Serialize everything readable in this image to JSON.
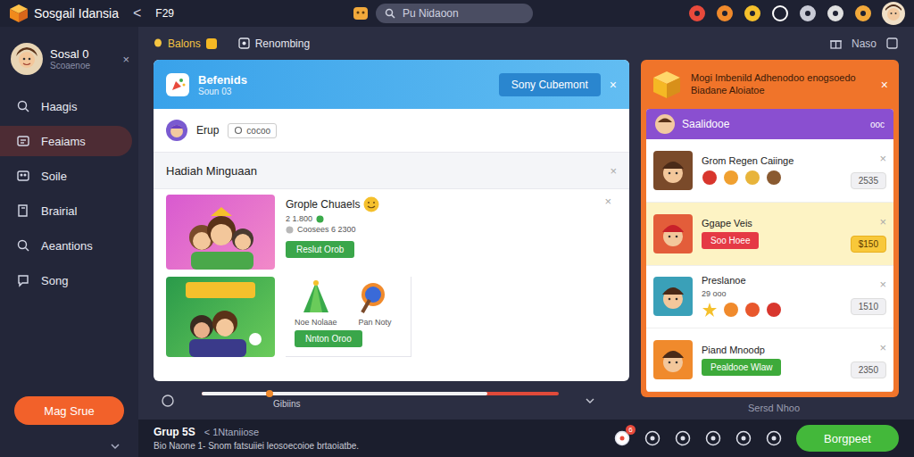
{
  "app": {
    "title": "Sosgail Idansia",
    "back": "<",
    "counter": "F29"
  },
  "search": {
    "placeholder": "Pu Nidaoon"
  },
  "sidebar": {
    "profile": {
      "name": "Sosal 0",
      "subtitle": "Scoaenoe",
      "close": "×"
    },
    "items": [
      {
        "label": "Haagis",
        "selected": false
      },
      {
        "label": "Feaiams",
        "selected": true
      },
      {
        "label": "Soile",
        "selected": false
      },
      {
        "label": "Brairial",
        "selected": false
      },
      {
        "label": "Aeantions",
        "selected": false
      },
      {
        "label": "Song",
        "selected": false
      }
    ],
    "button": "Mag Srue"
  },
  "toolbar": {
    "tabs": [
      {
        "label": "Balons",
        "selected": true
      },
      {
        "label": "Renombing",
        "selected": false
      }
    ],
    "right_label": "Naso"
  },
  "card": {
    "title": "Befenids",
    "subtitle": "Soun 03",
    "button": "Sony Cubemont",
    "close": "×",
    "group": {
      "name": "Erup",
      "chip": "cocoo"
    },
    "section": {
      "title": "Hadiah Minguaan",
      "close": "×"
    },
    "rewards": [
      {
        "kind": "single",
        "title": "Grople Chuaels",
        "meta": "2 1.800",
        "detail": "Coosees 6 2300",
        "button": "Reslut Orob",
        "close": "×"
      },
      {
        "kind": "pair",
        "items": [
          {
            "label": "Noe Nolaae"
          },
          {
            "label": "Pan Noty"
          }
        ],
        "button": "Nnton Oroo"
      }
    ]
  },
  "progress": {
    "level": 0.8,
    "marker": 0.18,
    "label": "Gibiins"
  },
  "offer": {
    "title": "Mogi Imbenild Adhenodoo enogsoedo Biadane Aloiatoe",
    "close": "×",
    "header": {
      "name": "Saalidooe",
      "tag": "ooc"
    },
    "items": [
      {
        "kind": "icons",
        "title": "Grom Regen Caiinge",
        "sub": "",
        "price": "2535",
        "selected": false,
        "close": "×"
      },
      {
        "kind": "button",
        "title": "Ggape Veis",
        "button": "Soo Hoee",
        "color": "#e53945",
        "price": "$150",
        "selected": true,
        "close": "×"
      },
      {
        "kind": "icons",
        "title": "Preslanoe",
        "sub": "29 ooo",
        "price": "1510",
        "selected": false,
        "close": "×"
      },
      {
        "kind": "button",
        "title": "Piand Mnoodp",
        "button": "Pealdooe Wlaw",
        "color": "#3daa3a",
        "price": "2350",
        "selected": false,
        "close": "×"
      }
    ],
    "note": "Sersd Nhoo"
  },
  "bottom": {
    "group": "Grup 5S",
    "sub": "< 1Ntaniiose",
    "line": "Bio Naone 1- Snom fatsuiiei leosoecoioe brtaoiatbe.",
    "badge": "6",
    "button": "Borgpeet"
  }
}
